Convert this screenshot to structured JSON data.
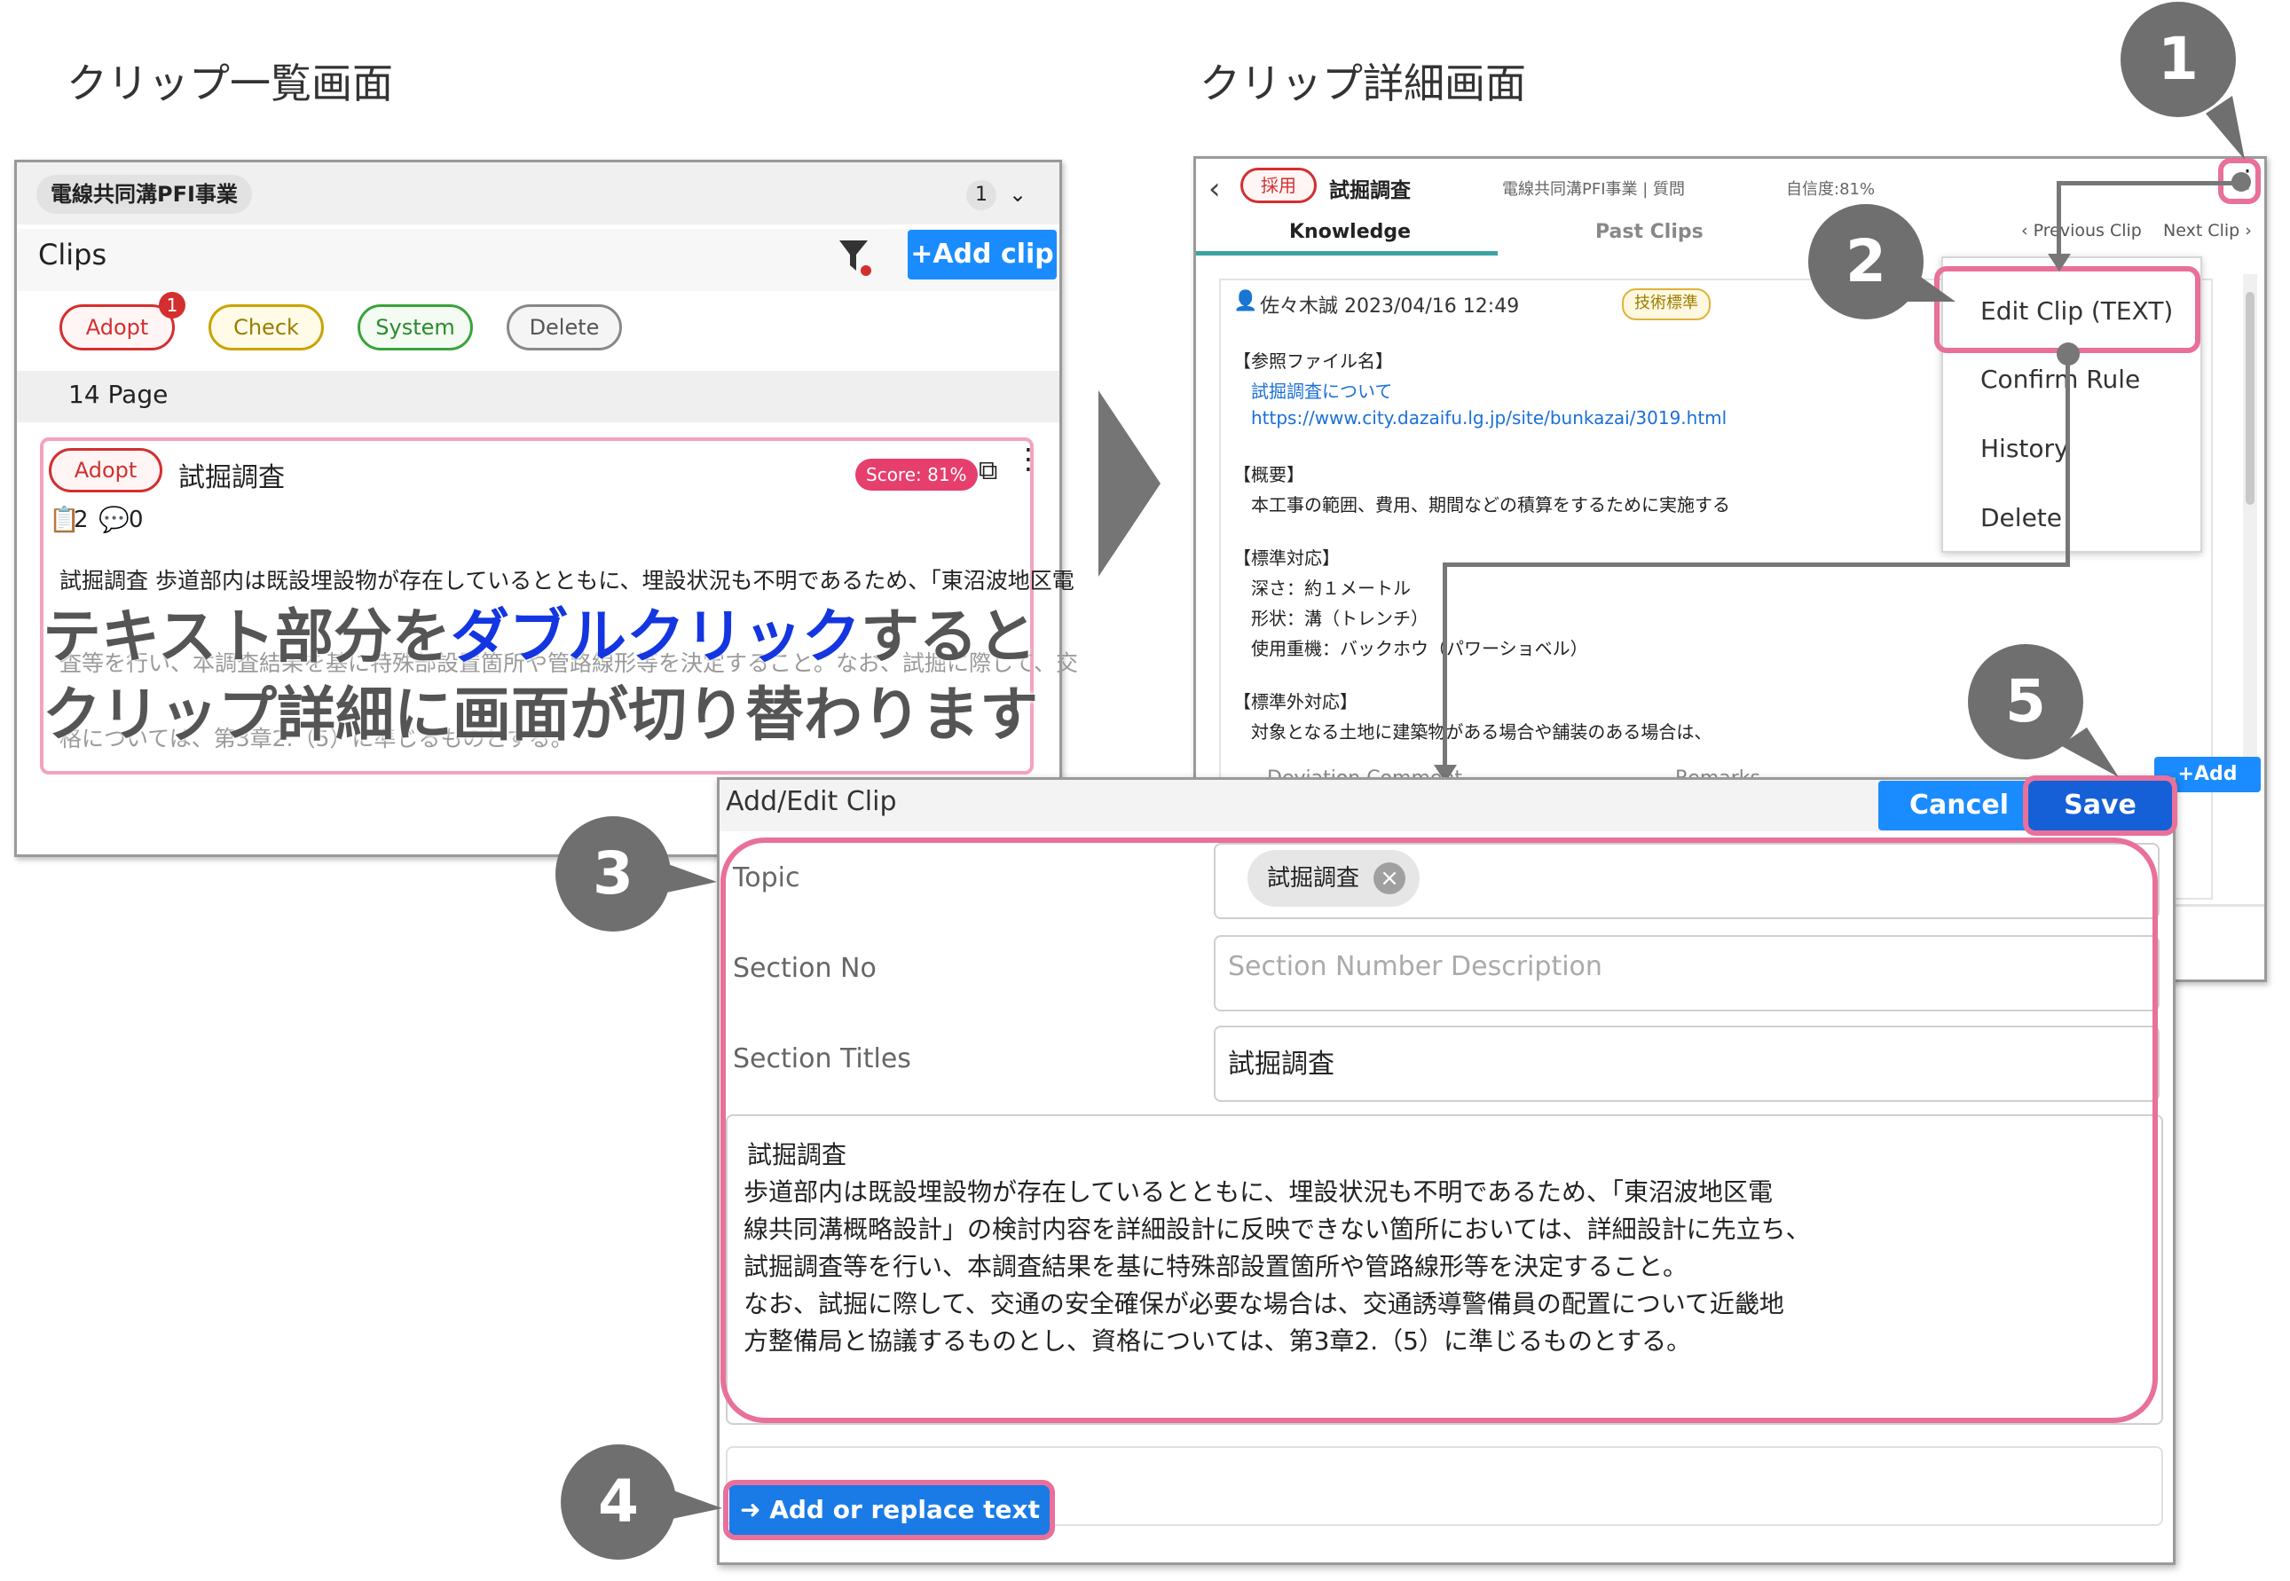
{
  "captions": {
    "left": "クリップ一覧画面",
    "right": "クリップ詳細画面"
  },
  "list_screen": {
    "project_tag": "電線共同溝PFI事業",
    "count": "1",
    "title": "Clips",
    "add_clip": "+Add clip",
    "filters": [
      "Adopt",
      "Check",
      "System",
      "Delete"
    ],
    "adopt_badge": "1",
    "page_label": "14 Page",
    "card": {
      "status": "Adopt",
      "title": "試掘調査",
      "score": "Score: 81%",
      "clip_count": "2",
      "comment_count": "0",
      "text_line1": "試掘調査 歩道部内は既設埋設物が存在しているとともに、埋設状況も不明であるため、「東沼波地区電",
      "text_line2": "査等を行い、本調査結果を基に特殊部設置箇所や管路線形等を決定すること。なお、試掘に際して、交",
      "text_line3": "格については、第3章2.（5）に準じるものとする。"
    },
    "overlay_part1": "テキスト部分を",
    "overlay_highlight": "ダブルクリック",
    "overlay_part2": "すると",
    "overlay_line2": "クリップ詳細に画面が切り替わります"
  },
  "detail_screen": {
    "status": "採用",
    "title": "試掘調査",
    "project": "電線共同溝PFI事業 | 質問",
    "confidence": "自信度:81%",
    "tabs": [
      "Knowledge",
      "Past Clips"
    ],
    "prev_clip": "Previous Clip",
    "next_clip": "Next Clip",
    "author": "佐々木誠 2023/04/16 12:49",
    "tag": "技術標準",
    "ref_heading": "【参照ファイル名】",
    "ref_link1": "試掘調査について",
    "ref_link2": "https://www.city.dazaifu.lg.jp/site/bunkazai/3019.html",
    "summary_heading": "【概要】",
    "summary_text": "本工事の範囲、費用、期間などの積算をするために実施する",
    "standard_heading": "【標準対応】",
    "standard_lines": [
      "深さ：約１メートル",
      "形状：溝（トレンチ）",
      "使用重機：バックホウ（パワーショベル）"
    ],
    "nonstandard_heading": "【標準外対応】",
    "nonstandard_text": "対象となる土地に建築物がある場合や舗装のある場合は、",
    "menu": [
      "Edit Clip (TEXT)",
      "Confirm Rule",
      "History",
      "Delete"
    ],
    "bottom_tabs": [
      "Deviation Comment",
      "Remarks"
    ],
    "add_label": "+Add"
  },
  "edit_dialog": {
    "title": "Add/Edit Clip",
    "cancel": "Cancel",
    "save": "Save",
    "topic_label": "Topic",
    "topic_chip": "試掘調査",
    "section_no_label": "Section No",
    "section_no_placeholder": "Section Number Description",
    "section_titles_label": "Section Titles",
    "section_titles_value": "試掘調査",
    "body_lines": [
      "試掘調査",
      "歩道部内は既設埋設物が存在しているとともに、埋設状況も不明であるため、「東沼波地区電",
      "線共同溝概略設計」の検討内容を詳細設計に反映できない箇所においては、詳細設計に先立ち、",
      "試掘調査等を行い、本調査結果を基に特殊部設置箇所や管路線形等を決定すること。",
      "なお、試掘に際して、交通の安全確保が必要な場合は、交通誘導警備員の配置について近畿地",
      "方整備局と協議するものとし、資格については、第3章2.（5）に準じるものとする。"
    ],
    "add_replace": "Add or replace text"
  },
  "steps": [
    "1",
    "2",
    "3",
    "4",
    "5"
  ],
  "colors": {
    "accent": "#1a8cff",
    "highlight": "#e8709a",
    "step": "#6f6f6f"
  }
}
